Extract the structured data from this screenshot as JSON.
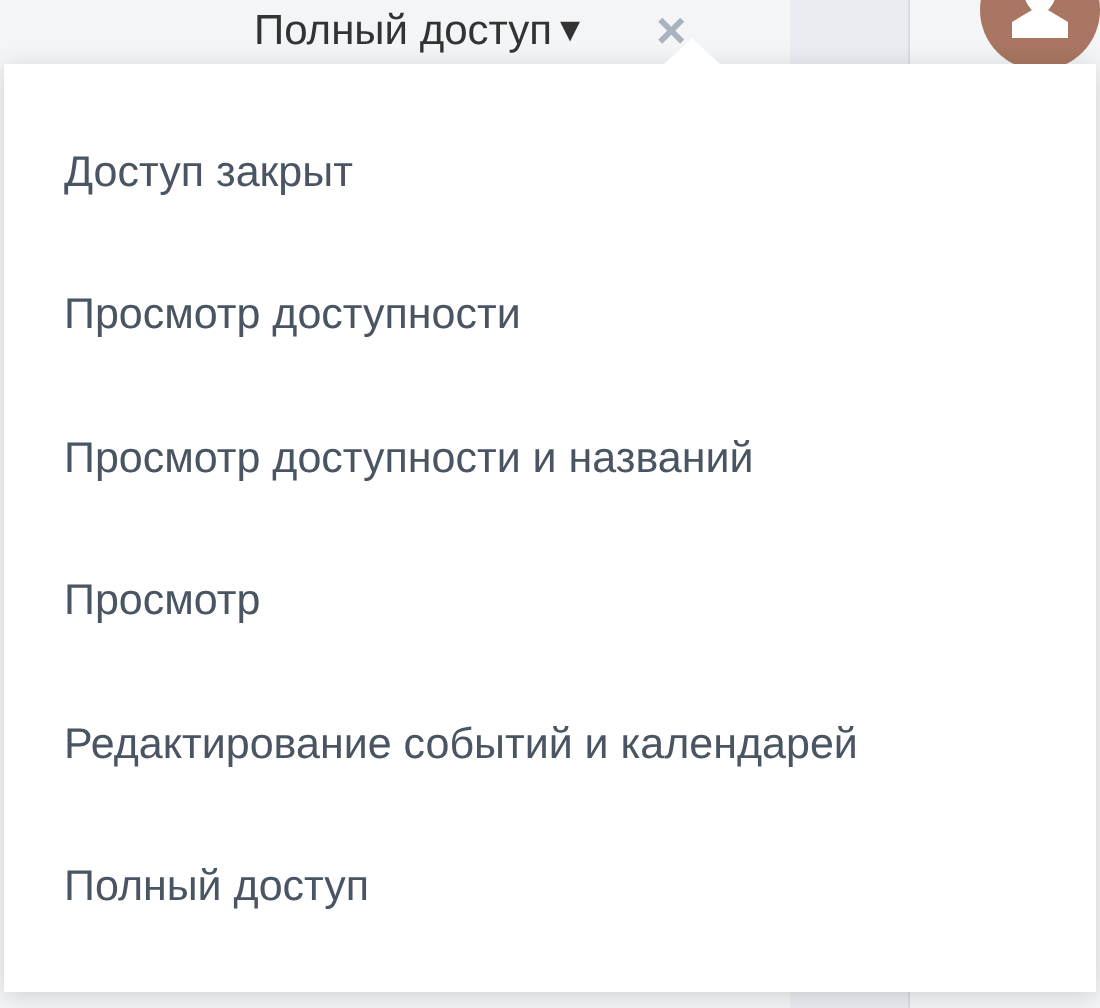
{
  "trigger": {
    "label": "Полный доступ",
    "caret": "▾",
    "close": "×"
  },
  "menu": {
    "items": [
      {
        "label": "Доступ закрыт"
      },
      {
        "label": "Просмотр доступности"
      },
      {
        "label": "Просмотр доступности и названий"
      },
      {
        "label": "Просмотр"
      },
      {
        "label": "Редактирование событий и календарей"
      },
      {
        "label": "Полный доступ"
      }
    ]
  }
}
